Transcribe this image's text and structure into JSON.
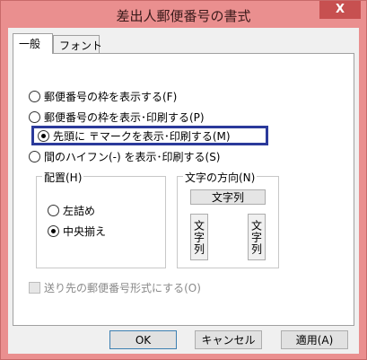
{
  "window": {
    "title": "差出人郵便番号の書式",
    "close_label": "X"
  },
  "tabs": [
    {
      "label": "一般",
      "active": true
    },
    {
      "label": "フォント",
      "active": false
    }
  ],
  "options": [
    {
      "label": "郵便番号の枠を表示する(F)",
      "checked": false
    },
    {
      "label": "郵便番号の枠を表示･印刷する(P)",
      "checked": false
    },
    {
      "label": "先頭に 〒マークを表示･印刷する(M)",
      "checked": true
    },
    {
      "label": "間のハイフン(-) を表示･印刷する(S)",
      "checked": false
    }
  ],
  "placement": {
    "label": "配置(H)",
    "options": [
      {
        "label": "左詰め",
        "checked": false
      },
      {
        "label": "中央揃え",
        "checked": true
      }
    ]
  },
  "text_direction": {
    "label": "文字の方向(N)",
    "horizontal_label": "文字列",
    "vertical_left_label": "文字列",
    "vertical_right_label": "文字列"
  },
  "recipient_format": {
    "label": "送り先の郵便番号形式にする(O)",
    "checked": false,
    "enabled": false
  },
  "buttons": {
    "ok": "OK",
    "cancel": "キャンセル",
    "apply": "適用(A)"
  }
}
